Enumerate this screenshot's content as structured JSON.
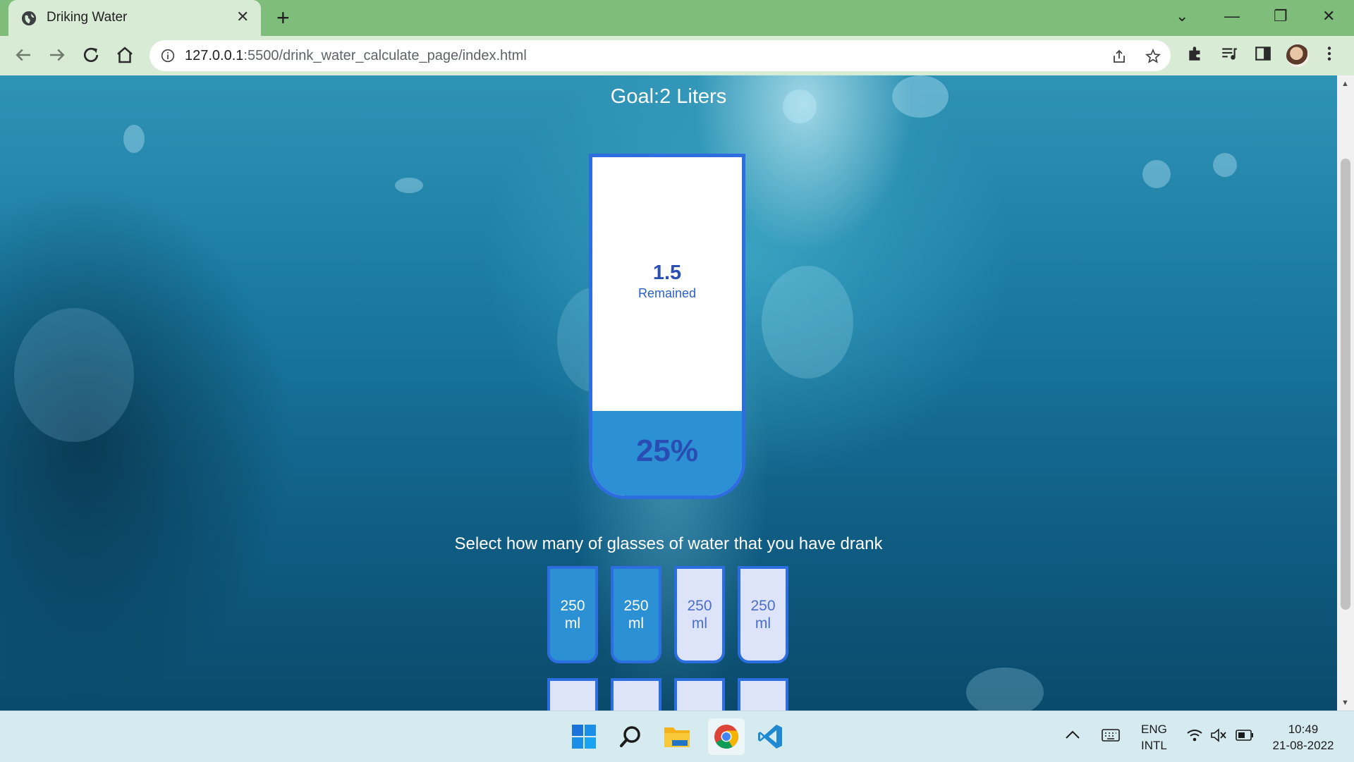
{
  "browser": {
    "tab_title": "Driking Water",
    "close_glyph": "✕",
    "new_tab_glyph": "+",
    "url_host": "127.0.0.1",
    "url_rest": ":5500/drink_water_calculate_page/index.html",
    "window_controls": [
      "⌄",
      "—",
      "❐",
      "✕"
    ]
  },
  "page": {
    "goal": "Goal:2 Liters",
    "remained_value": "1.5",
    "remained_label": "Remained",
    "percentage_text": "25%",
    "percentage_fill": 0.25,
    "instruction": "Select how many of glasses of water that you have drank",
    "glasses": [
      {
        "size": "250",
        "unit": "ml",
        "full": true
      },
      {
        "size": "250",
        "unit": "ml",
        "full": true
      },
      {
        "size": "250",
        "unit": "ml",
        "full": false
      },
      {
        "size": "250",
        "unit": "ml",
        "full": false
      }
    ],
    "colors": {
      "cup_border": "#2d6de0",
      "water": "#2b91d4",
      "empty_glass": "#dde3f8"
    }
  },
  "taskbar": {
    "lang_line1": "ENG",
    "lang_line2": "INTL",
    "time": "10:49",
    "date": "21-08-2022",
    "apps": [
      "windows-start-icon",
      "search-icon",
      "file-explorer-icon",
      "chrome-icon",
      "vscode-icon"
    ]
  }
}
